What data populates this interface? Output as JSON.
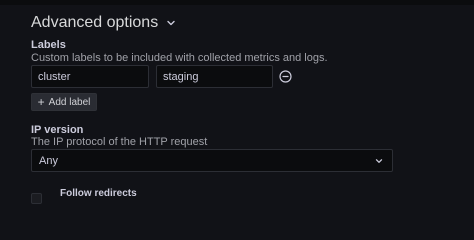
{
  "section": {
    "title": "Advanced options",
    "toggle_icon": "chevron-down-icon"
  },
  "labels": {
    "label": "Labels",
    "description": "Custom labels to be included with collected metrics and logs.",
    "rows": [
      {
        "key": "cluster",
        "value": "staging"
      }
    ],
    "remove_icon": "minus-circle-icon",
    "add_button_label": "Add label",
    "add_icon": "plus-icon"
  },
  "ip_version": {
    "label": "IP version",
    "description": "The IP protocol of the HTTP request",
    "selected": "Any",
    "dropdown_icon": "chevron-down-icon"
  },
  "follow_redirects": {
    "label": "Follow redirects",
    "checked": false
  }
}
